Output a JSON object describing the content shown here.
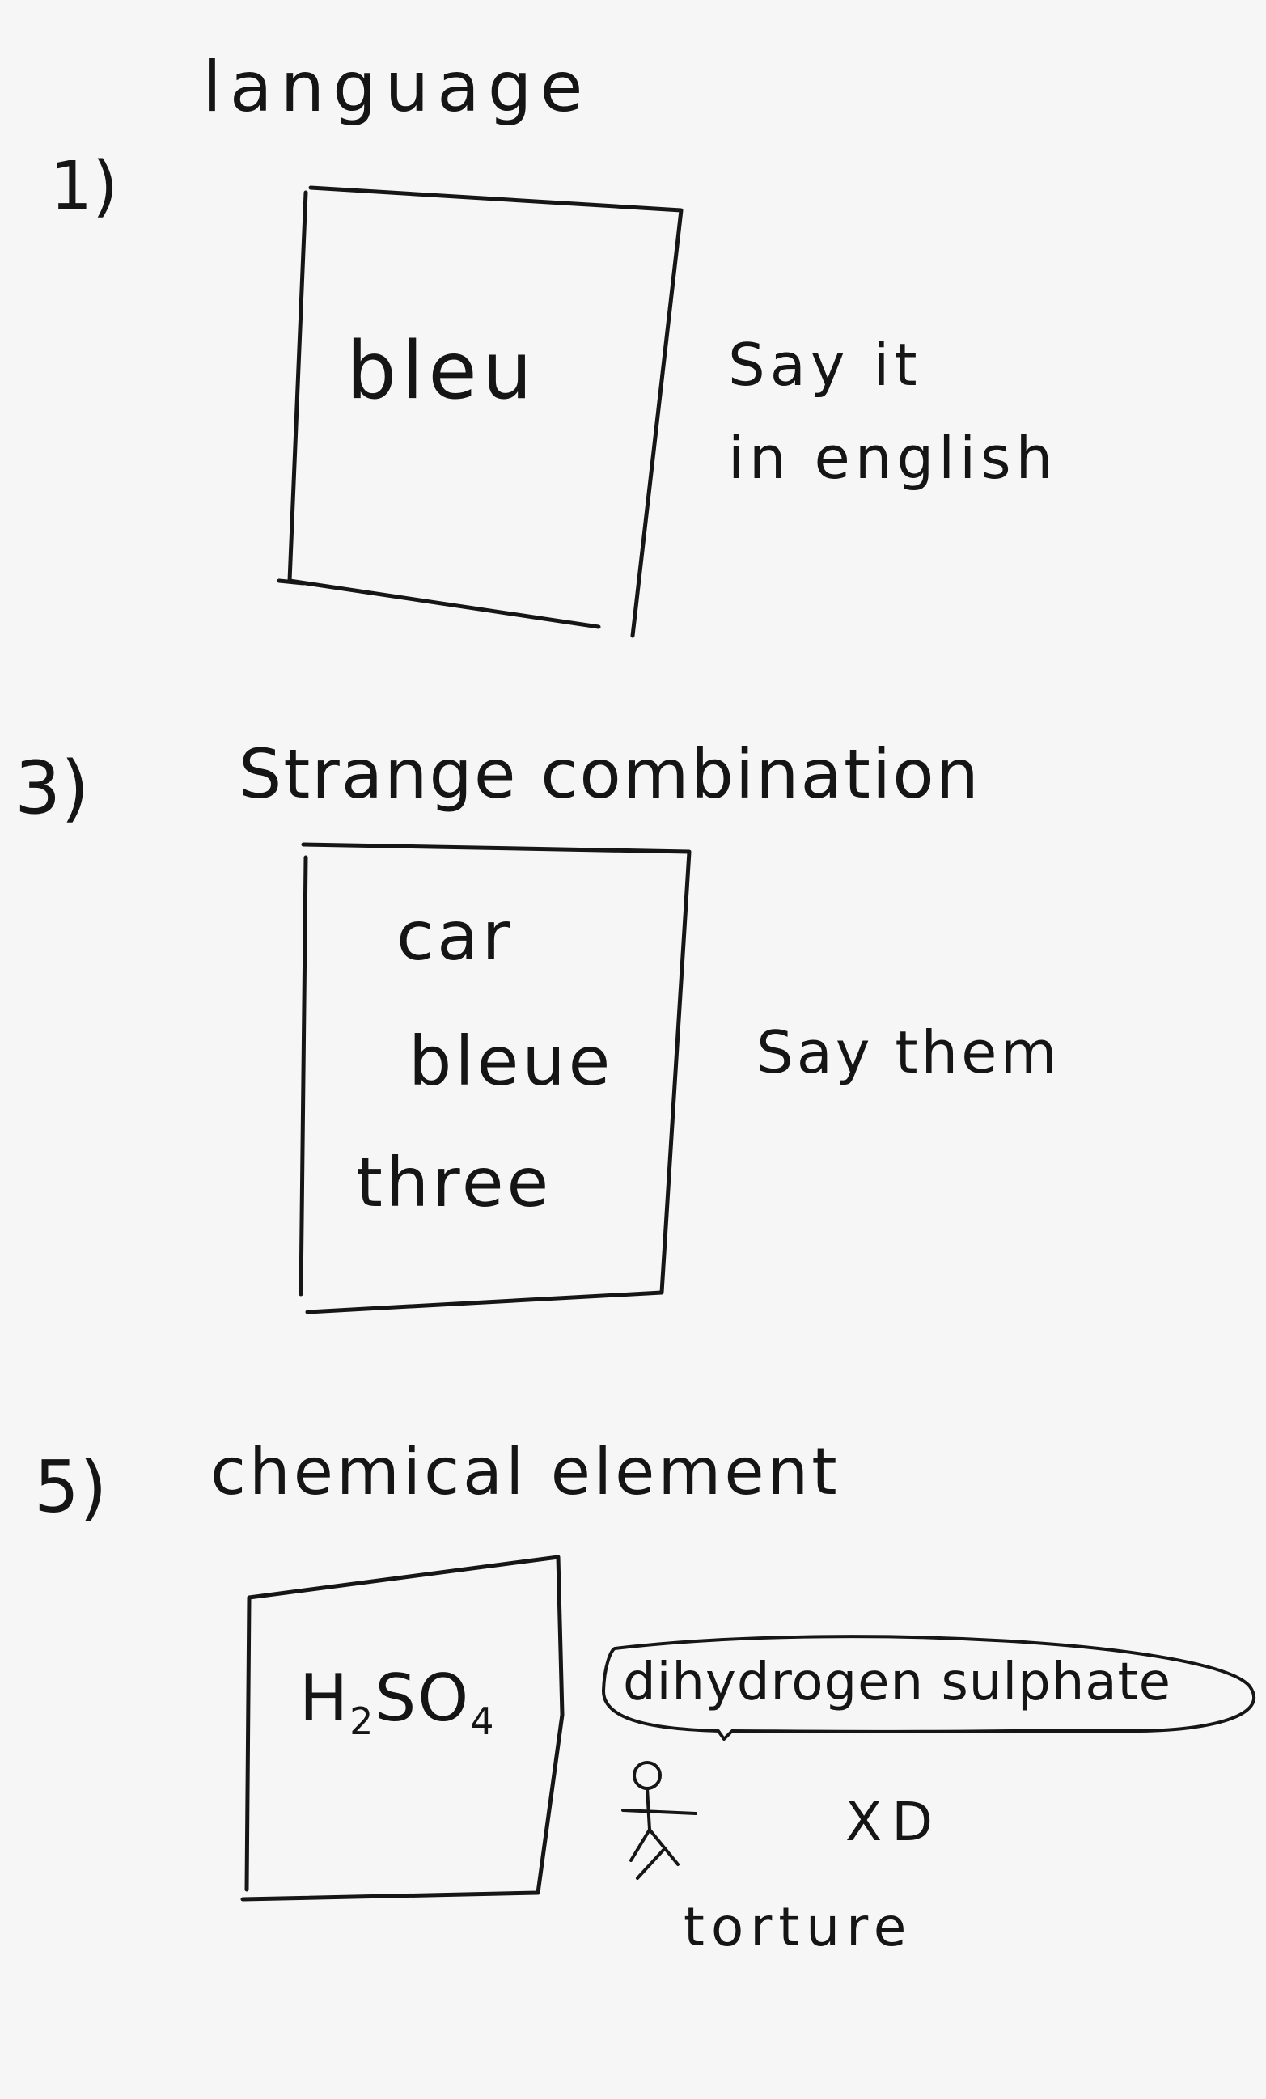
{
  "sections": [
    {
      "number": "1)",
      "title": "language",
      "card_words": [
        "bleu"
      ],
      "note_lines": [
        "Say it",
        "in english"
      ]
    },
    {
      "number": "3)",
      "title": "Strange combination",
      "card_words": [
        "car",
        "bleue",
        "three"
      ],
      "note_lines": [
        "Say them"
      ]
    },
    {
      "number": "5)",
      "title": "chemical element",
      "card_formula": {
        "h": "H",
        "sub": "2",
        "rest": "SO",
        "sub2": "4"
      },
      "speech_bubble": "dihydrogen sulphate",
      "face": "XD",
      "caption": "torture"
    }
  ]
}
